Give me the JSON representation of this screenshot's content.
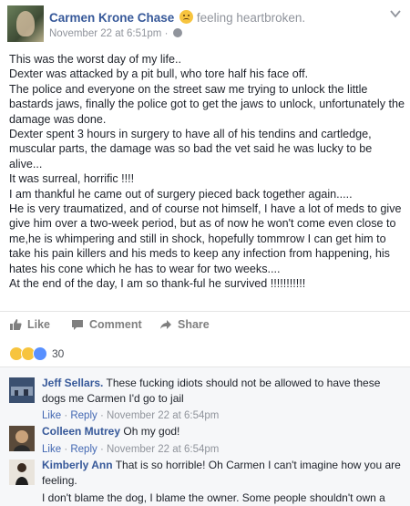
{
  "post": {
    "author": "Carmen Krone Chase",
    "feeling": "feeling heartbroken.",
    "timestamp": "November 22 at 6:51pm",
    "separator": "·",
    "lines": [
      "This was the worst day of my life..",
      "Dexter was attacked by a pit bull, who tore half his face off.",
      "The police and everyone on the street saw me trying to unlock the little bastards jaws, finally the police got to get the jaws to unlock, unfortunately the damage was done.",
      "Dexter spent 3 hours in surgery to have all of his tendins and cartledge, muscular parts, the damage was so bad the vet said he was lucky to be alive...",
      "It was surreal, horrific !!!!",
      "I am thankful he came out of surgery pieced back together again.....",
      "He is very traumatized, and of course not himself, I have a lot of meds to give give him over a two-week period, but as of now he won't come even close to me,he is whimpering and still in shock, hopefully tommrow I can get him to take his pain killers and his meds to keep any infection from happening, his hates his cone which he has to wear for two weeks....",
      "At the end of the day, I am so thank-ful he survived !!!!!!!!!!!"
    ]
  },
  "actions": {
    "like": "Like",
    "comment": "Comment",
    "share": "Share"
  },
  "reactions": {
    "count": "30",
    "icons": [
      "sad-reaction",
      "wow-reaction",
      "like-reaction"
    ]
  },
  "comments": [
    {
      "author": "Jeff Sellars.",
      "text": "These fucking idiots should not be allowed to have these dogs me Carmen I'd go to jail",
      "like": "Like",
      "reply": "Reply",
      "time": "November 22 at 6:54pm"
    },
    {
      "author": "Colleen Mutrey",
      "text": "Oh my god!",
      "like": "Like",
      "reply": "Reply",
      "time": "November 22 at 6:54pm"
    },
    {
      "author": "Kimberly Ann",
      "text": "That is so horrible! Oh Carmen I can't imagine how you are feeling.",
      "text2": "I don't blame the dog, I blame the owner. Some people shouldn't own a dog, let alone a dog breed like that if they can't control them."
    }
  ],
  "colors": {
    "link": "#365899",
    "meta": "#90949c",
    "text": "#1d2129"
  }
}
